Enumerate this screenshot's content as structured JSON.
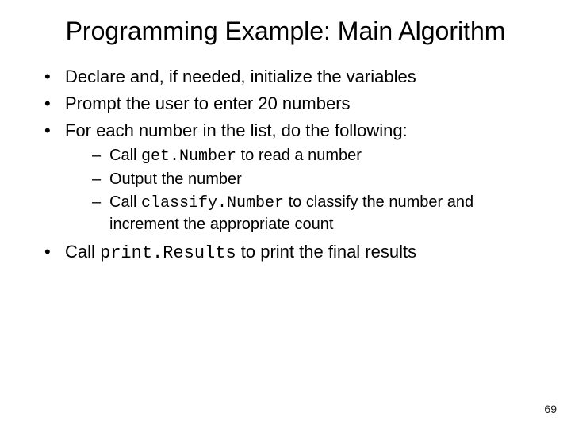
{
  "title": "Programming Example: Main Algorithm",
  "b1": "Declare and, if needed, initialize the variables",
  "b2": "Prompt the user to enter 20 numbers",
  "b3": "For each number in the list, do the following:",
  "s1a": "Call ",
  "s1code": "get.Number",
  "s1b": " to read a number",
  "s2": "Output the number",
  "s3a": "Call ",
  "s3code": "classify.Number",
  "s3b": " to classify the number and increment the appropriate count",
  "b4a": "Call ",
  "b4code": "print.Results",
  "b4b": " to print the final results",
  "page": "69"
}
